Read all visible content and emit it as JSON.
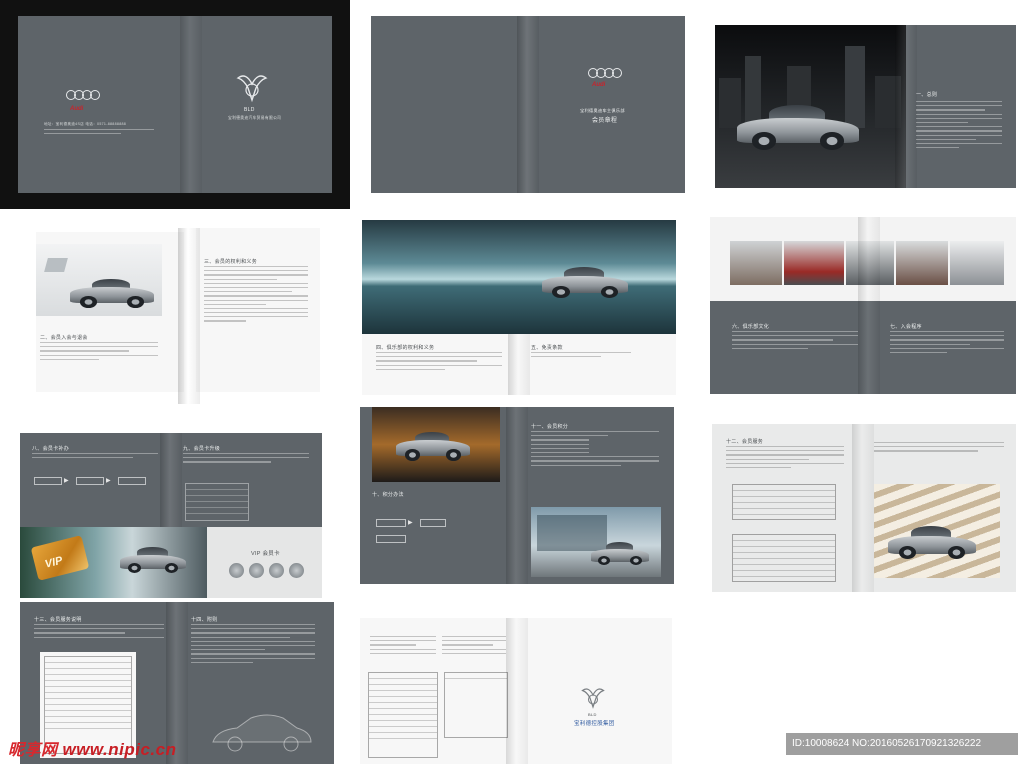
{
  "spreads": {
    "s1": {
      "brand_word": "Audi",
      "logo_initials": "BLD",
      "cover_caption": "宝利德奥迪汽车贸易有限公司",
      "back_text": "地址：宝利德奥迪4S店  电话：0571-88888888"
    },
    "s2": {
      "brand_word": "Audi",
      "title": "会员章程",
      "subtitle": "宝利德奥迪车主俱乐部"
    },
    "s3": {
      "heading": "一、总则"
    },
    "s4": {
      "heading_left": "二、会员入会与退会",
      "heading_right": "三、会员的权利和义务"
    },
    "s5": {
      "heading_left": "四、俱乐部的权利和义务",
      "heading_right": "五、免责条款"
    },
    "s6": {
      "heading_left": "六、俱乐部文化",
      "heading_right": "七、入会程序"
    },
    "s7": {
      "heading_left": "八、会员卡补办",
      "heading_right": "九、会员卡升级",
      "vip_label": "VIP 会员卡",
      "card_word": "VIP"
    },
    "s8": {
      "heading_left": "十、积分办法",
      "heading_right": "十一、会员积分"
    },
    "s9": {
      "heading_left": "十二、会员服务"
    },
    "s10": {
      "heading_left": "十三、会员服务说明",
      "heading_right": "十四、附则"
    },
    "s11": {
      "logo_initials": "BLD",
      "group_name": "宝利德控股集团"
    }
  },
  "watermark": {
    "site": "昵享网",
    "url": "www.nipic.cn"
  },
  "image_id": "ID:10008624 NO:20160526170921326222",
  "colors": {
    "slate": "#5e6469",
    "audi_red": "#c8232c",
    "paper": "#e9eaea"
  }
}
